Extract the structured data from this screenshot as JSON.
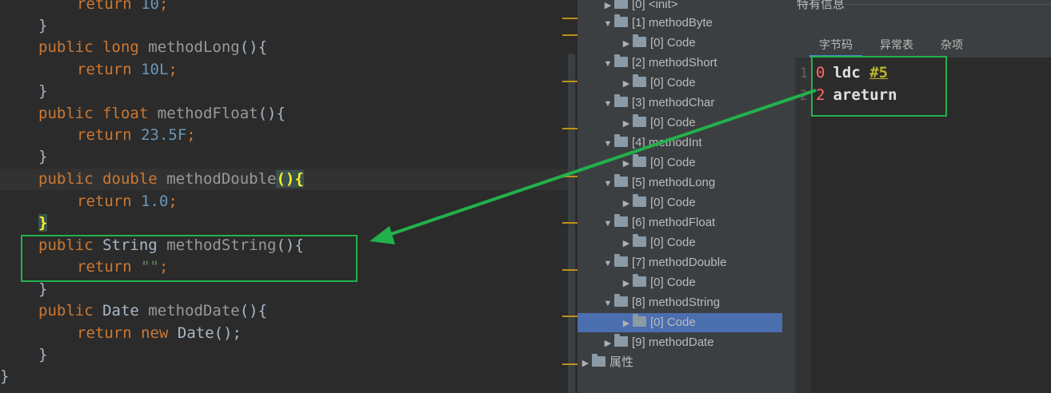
{
  "editor": {
    "lines": {
      "l0": {
        "kw": "return",
        "num": "10",
        "end": ";"
      },
      "l1": {
        "brace": "}"
      },
      "l2": {
        "kw1": "public",
        "kw2": "long",
        "name": "methodLong",
        "end": "(){"
      },
      "l3": {
        "kw": "return",
        "num": "10L",
        "end": ";"
      },
      "l4": {
        "brace": "}"
      },
      "l5": {
        "kw1": "public",
        "kw2": "float",
        "name": "methodFloat",
        "end": "(){"
      },
      "l6": {
        "kw": "return",
        "num": "23.5F",
        "end": ";"
      },
      "l7": {
        "brace": "}"
      },
      "l8": {
        "kw1": "public",
        "kw2": "double",
        "name": "methodDouble",
        "paren": "()",
        "cbrace": "{"
      },
      "l9": {
        "kw": "return",
        "num": "1.0",
        "end": ";"
      },
      "l10": {
        "brace": "}"
      },
      "l11": {
        "kw1": "public",
        "type": "String",
        "name": "methodString",
        "end": "(){"
      },
      "l12": {
        "kw": "return",
        "str": "\"\"",
        "end": ";"
      },
      "l13": {
        "brace": "}"
      },
      "l14": {
        "kw1": "public",
        "type": "Date",
        "name": "methodDate",
        "end": "(){"
      },
      "l15": {
        "kw1": "return",
        "kw2": "new",
        "type": "Date",
        "end": "();"
      },
      "l16": {
        "brace": "}"
      },
      "l17": {
        "brace": "}"
      }
    }
  },
  "tree": {
    "items": [
      {
        "label": "[0] <init>",
        "expanded": false
      },
      {
        "label": "[1] methodByte",
        "expanded": true
      },
      {
        "label": "[0] Code"
      },
      {
        "label": "[2] methodShort",
        "expanded": true
      },
      {
        "label": "[0] Code"
      },
      {
        "label": "[3] methodChar",
        "expanded": true
      },
      {
        "label": "[0] Code"
      },
      {
        "label": "[4] methodInt",
        "expanded": true
      },
      {
        "label": "[0] Code"
      },
      {
        "label": "[5] methodLong",
        "expanded": true
      },
      {
        "label": "[0] Code"
      },
      {
        "label": "[6] methodFloat",
        "expanded": true
      },
      {
        "label": "[0] Code"
      },
      {
        "label": "[7] methodDouble",
        "expanded": true
      },
      {
        "label": "[0] Code"
      },
      {
        "label": "[8] methodString",
        "expanded": true
      },
      {
        "label": "[0] Code",
        "selected": true
      },
      {
        "label": "[9] methodDate",
        "expanded": false
      },
      {
        "label": "属性",
        "expanded": false
      }
    ]
  },
  "panel": {
    "title": "特有信息",
    "tabs": [
      "字节码",
      "异常表",
      "杂项"
    ],
    "active_tab": "字节码",
    "bytecode": [
      {
        "line": "1",
        "offset": "0",
        "opcode": "ldc",
        "operand": "#5"
      },
      {
        "line": "2",
        "offset": "2",
        "opcode": "areturn",
        "operand": ""
      }
    ]
  },
  "colors": {
    "annotation": "#22b14c",
    "selection": "#4b6eaf",
    "keyword": "#cc7832",
    "number": "#6897bb"
  }
}
